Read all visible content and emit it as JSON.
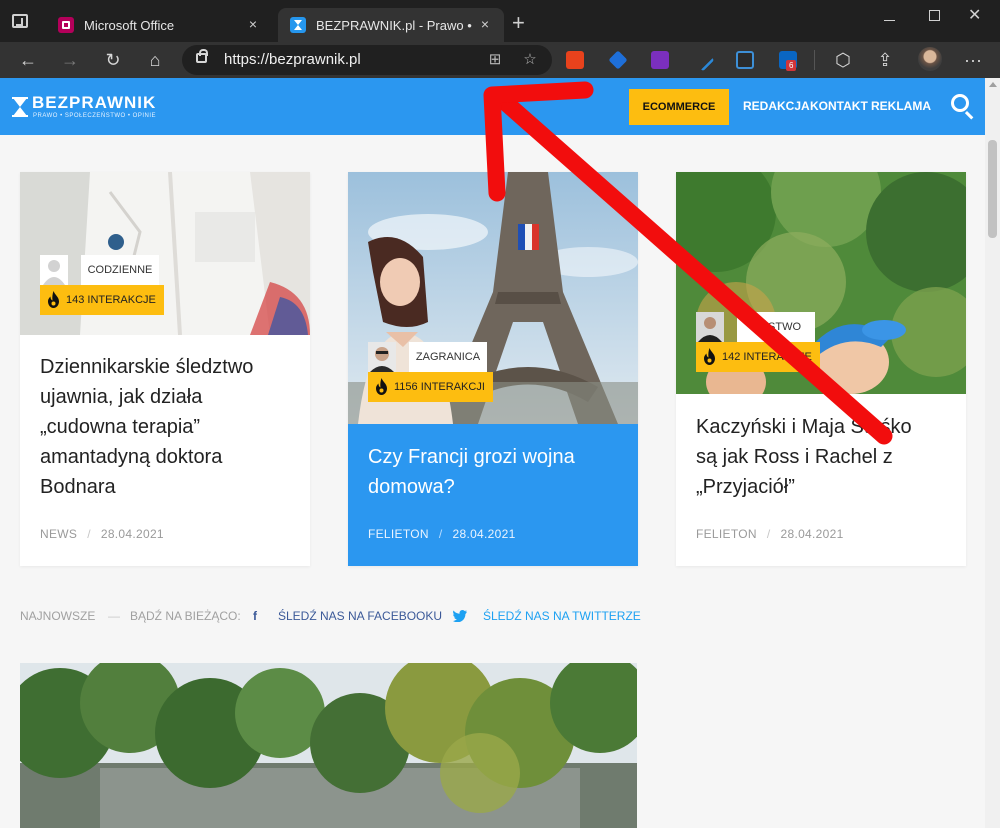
{
  "browser": {
    "tabs": [
      {
        "title": "Microsoft Office",
        "active": false
      },
      {
        "title": "BEZPRAWNIK.pl - Prawo • Społeczeństwo • Opinie",
        "active": true
      }
    ],
    "address_bar": {
      "url": "https://bezprawnik.pl"
    },
    "extension_badge": "6",
    "icons": {
      "tab_actions": "tab-actions-icon",
      "close": "×",
      "new_tab": "+",
      "back": "←",
      "forward": "→",
      "refresh": "↻",
      "home": "⌂",
      "more": "···",
      "win_close": "✕"
    }
  },
  "site": {
    "logo": {
      "name": "BEZPRAWNIK",
      "tagline": "PRAWO • SPOŁECZEŃSTWO • OPINIE"
    },
    "nav": {
      "highlight": "ECOMMERCE",
      "items": [
        "REDAKCJA",
        "KONTAKT",
        "REKLAMA"
      ]
    },
    "colors": {
      "brand_blue": "#2b97f0",
      "accent_yellow": "#fdbd10"
    }
  },
  "cards": [
    {
      "category": "CODZIENNE",
      "interactions": "143 INTERAKCJE",
      "title_lines": [
        "Dziennikarskie śledztwo",
        "ujawnia, jak działa",
        "„cudowna terapia”",
        "amantadyną doktora",
        "Bodnara"
      ],
      "section": "NEWS",
      "date": "28.04.2021"
    },
    {
      "category": "ZAGRANICA",
      "interactions": "1156 INTERAKCJI",
      "title_lines": [
        "Czy Francji grozi wojna",
        "domowa?"
      ],
      "section": "FELIETON",
      "date": "28.04.2021"
    },
    {
      "category": "...ŃSTWO",
      "interactions": "142 INTERAKCJE",
      "title_lines": [
        "Kaczyński i Maja Staśko",
        "są jak Ross i Rachel z",
        "„Przyjaciół”"
      ],
      "section": "FELIETON",
      "date": "28.04.2021"
    }
  ],
  "social_bar": {
    "latest": "NAJNOWSZE",
    "dash": "—",
    "stay_updated": "BĄDŹ NA BIEŻĄCO:",
    "facebook": "ŚLEDŹ NAS NA FACEBOOKU",
    "twitter": "ŚLEDŹ NAS NA TWITTERZE"
  }
}
